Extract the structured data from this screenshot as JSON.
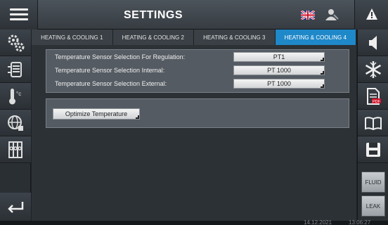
{
  "header": {
    "title": "SETTINGS",
    "menu_icon": "hamburger-icon",
    "language_icon": "uk-flag-icon",
    "user_icon": "user-wrench-icon",
    "alarm_icon": "warning-icon"
  },
  "tabs": [
    {
      "label": "HEATING & COOLING 1",
      "active": false
    },
    {
      "label": "HEATING & COOLING 2",
      "active": false
    },
    {
      "label": "HEATING & COOLING 3",
      "active": false
    },
    {
      "label": "HEATING & COOLING 4",
      "active": true
    }
  ],
  "left_sidebar": [
    {
      "icon": "gears-icon"
    },
    {
      "icon": "boiler-icon"
    },
    {
      "icon": "thermometer-celsius-icon"
    },
    {
      "icon": "globe-network-icon"
    },
    {
      "icon": "valves-icon"
    },
    {
      "icon": "back-arrow-icon"
    }
  ],
  "right_sidebar": {
    "icons": [
      "speaker-icon",
      "snowflake-icon",
      "pdf-icon",
      "manual-book-icon",
      "save-icon"
    ],
    "fluid_label": "FLUID",
    "leak_label": "LEAK"
  },
  "sensors": {
    "regulation": {
      "label": "Temperature Sensor Selection For Regulation:",
      "value": "PT1"
    },
    "internal": {
      "label": "Temperature Sensor Selection Internal:",
      "value": "PT 1000"
    },
    "external": {
      "label": "Temperature Sensor Selection External:",
      "value": "PT 1000"
    }
  },
  "optimize": {
    "label": "Optimize Temperature"
  },
  "status": {
    "date": "14.12.2021",
    "time": "13:06:27"
  },
  "colors": {
    "active_tab": "#1f88c9",
    "background": "#2c3136",
    "panel": "#545b62"
  }
}
